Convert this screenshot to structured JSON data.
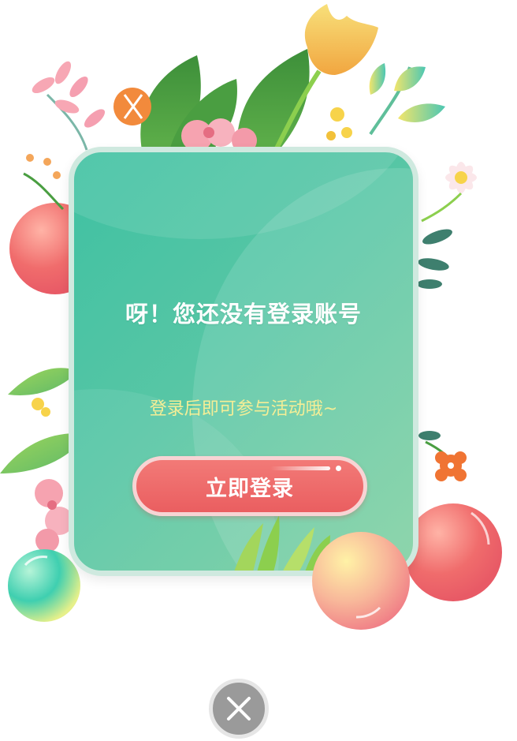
{
  "dialog": {
    "title": "呀！您还没有登录账号",
    "subtitle": "登录后即可参与活动哦~",
    "login_label": "立即登录"
  },
  "close": {
    "icon": "close-icon"
  },
  "colors": {
    "card_teal": "#3fc1a2",
    "button_red": "#ea5e60",
    "subtitle_yellow": "#f5ee96",
    "close_gray": "#9a9a9a"
  }
}
